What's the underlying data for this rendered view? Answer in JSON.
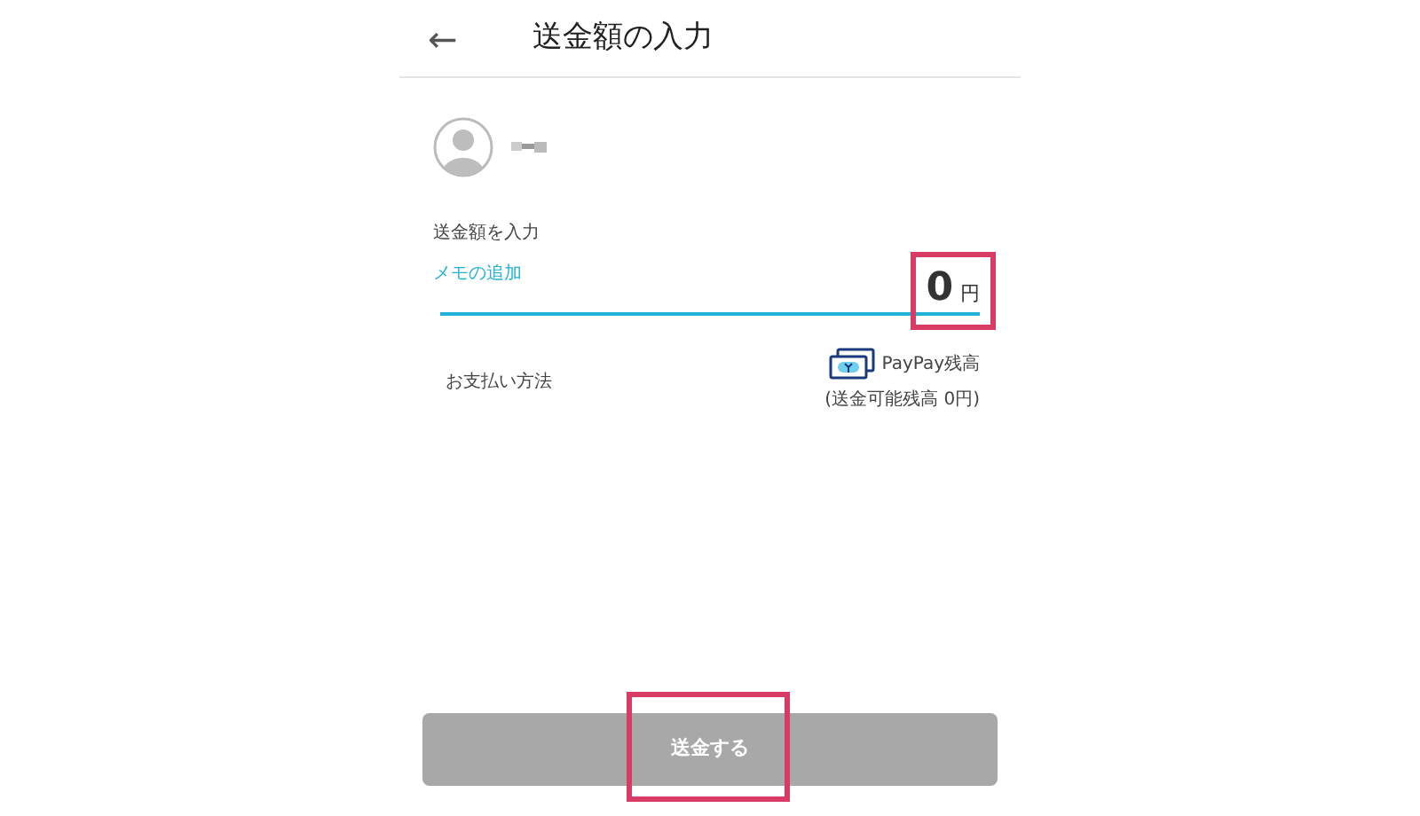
{
  "header": {
    "back": "←",
    "title": "送金額の入力"
  },
  "amount_label": "送金額を入力",
  "memo": {
    "label": "メモの追加"
  },
  "amount": {
    "value": "0",
    "unit": "円",
    "highlighted": true
  },
  "payment": {
    "label": "お支払い方法",
    "method": "PayPay残高",
    "note": "(送金可能残高 0円)"
  },
  "send_button": {
    "label": "送金する",
    "disabled": true,
    "highlighted": true
  }
}
